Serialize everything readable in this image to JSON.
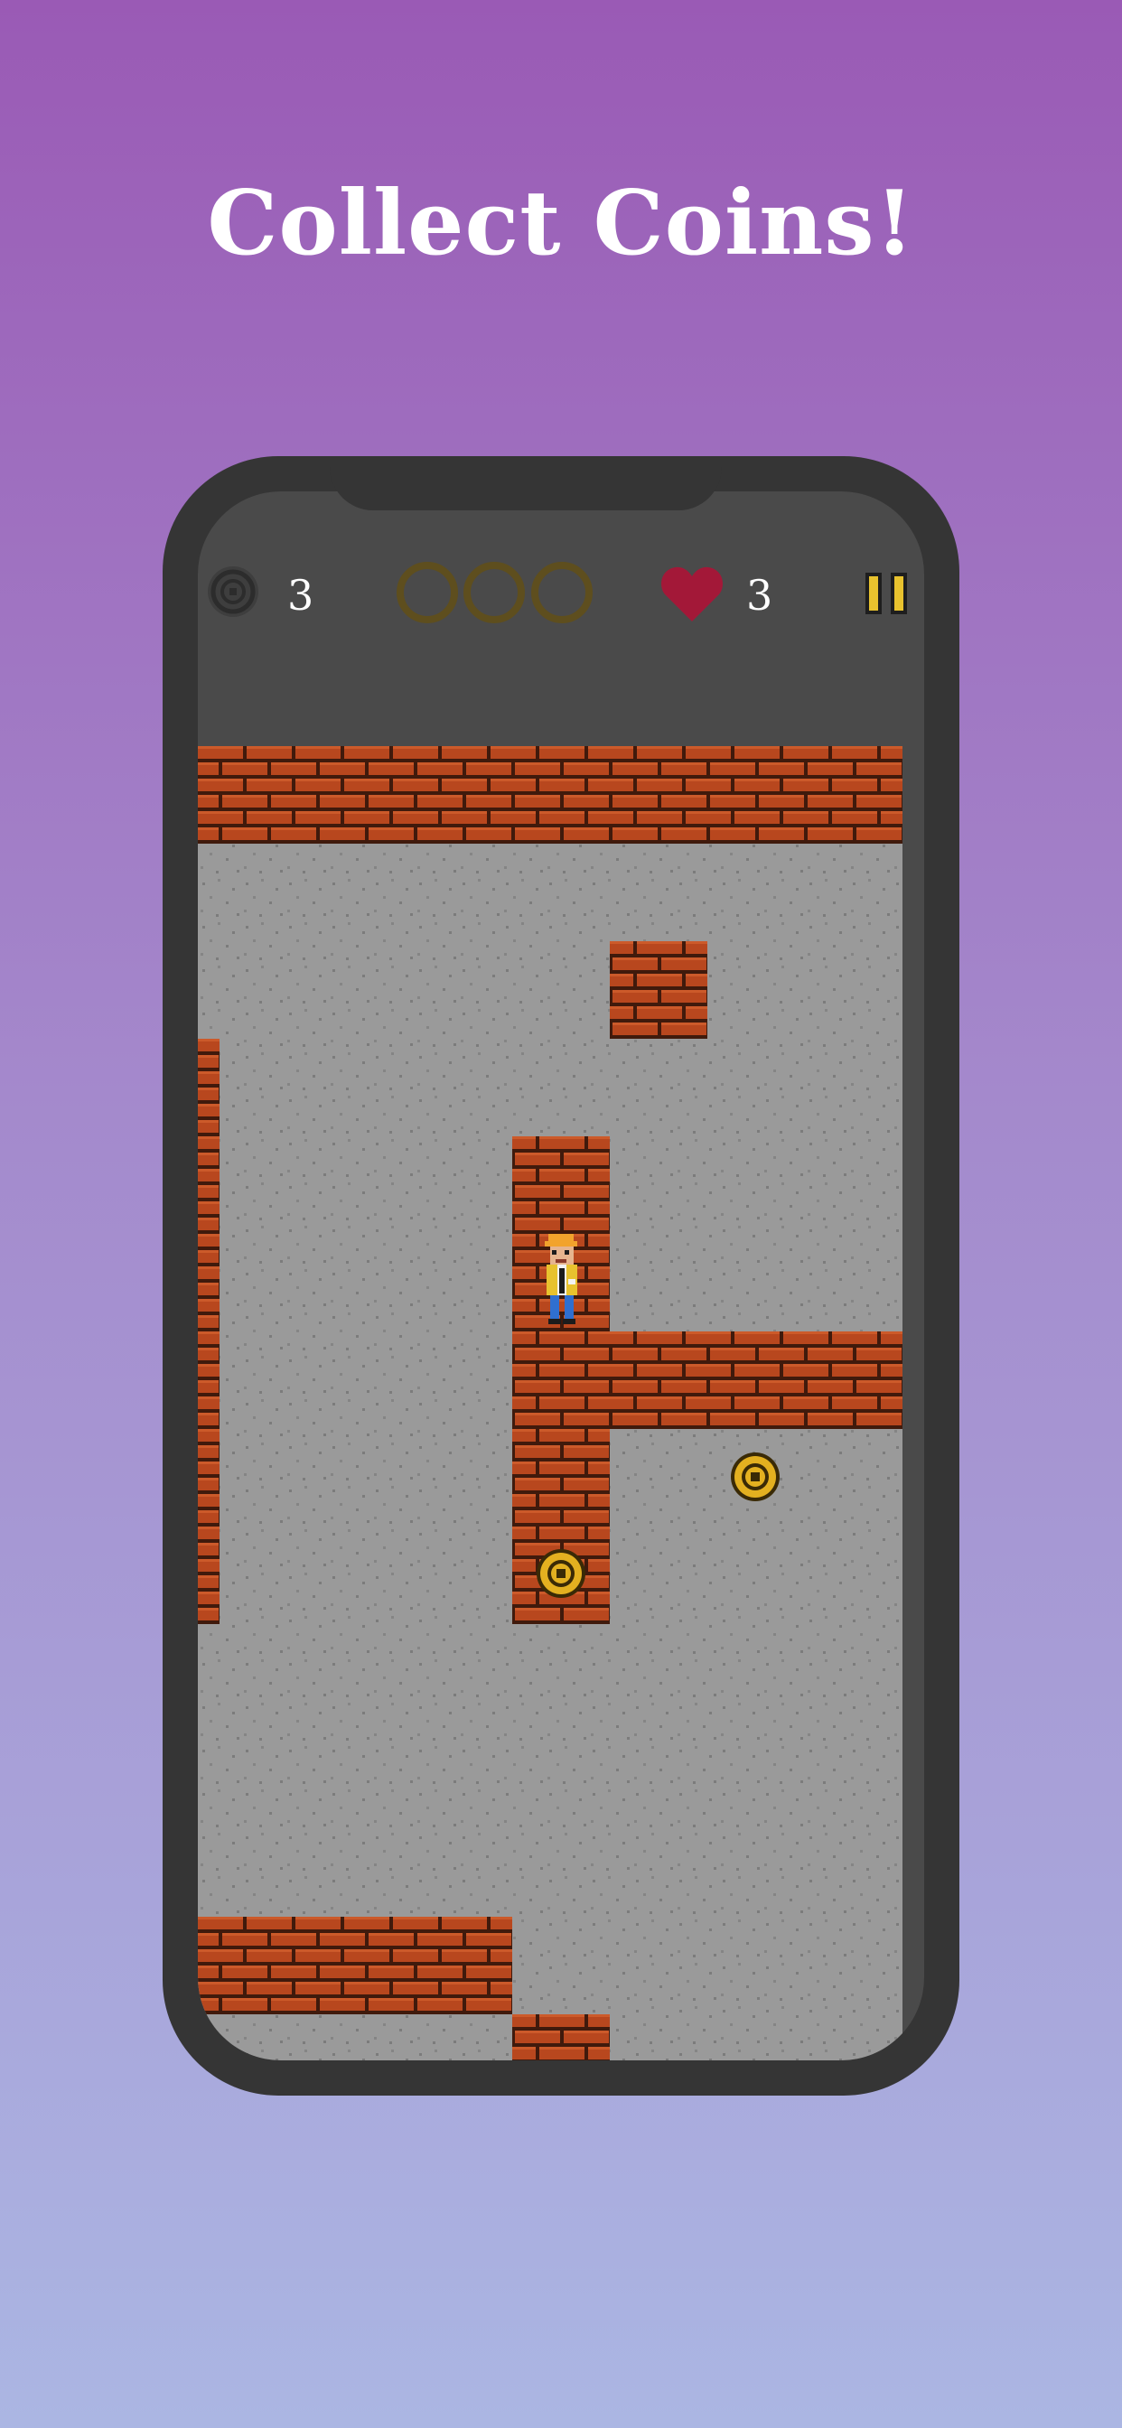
{
  "headline": "Collect Coins!",
  "hud": {
    "coin_counter": "3",
    "lives": "3",
    "level_coins_total": 3,
    "level_coins_collected": 0,
    "pause_label": "pause"
  },
  "colors": {
    "brick": "#b8471e",
    "mortar": "#401a0c",
    "floor": "#9a9a9a",
    "floor_speck": "#7c7c7c",
    "coin_gold": "#e3b020",
    "coin_dark": "#3a2a06",
    "heart": "#a31838",
    "pause": "#e8c22e",
    "empty_slot": "#5e4e1e"
  },
  "map": {
    "rows": [
      "WWWWWWWW",
      "........W",
      ".....W..W",
      "W.......W",
      "W...W...W",
      "W...W.P.W",
      "W...WWWWW",
      "W...W...W",
      "W...WC..W",
      "........W",
      "........W",
      "........W",
      "WWWW....W",
      "....W...W"
    ],
    "legend": {
      "W": "brick-wall",
      ".": "floor",
      "P": "player",
      "C": "coin"
    }
  },
  "extras": {
    "coins": [
      "coin-top-right",
      "coin-center"
    ],
    "player": "player-character"
  }
}
